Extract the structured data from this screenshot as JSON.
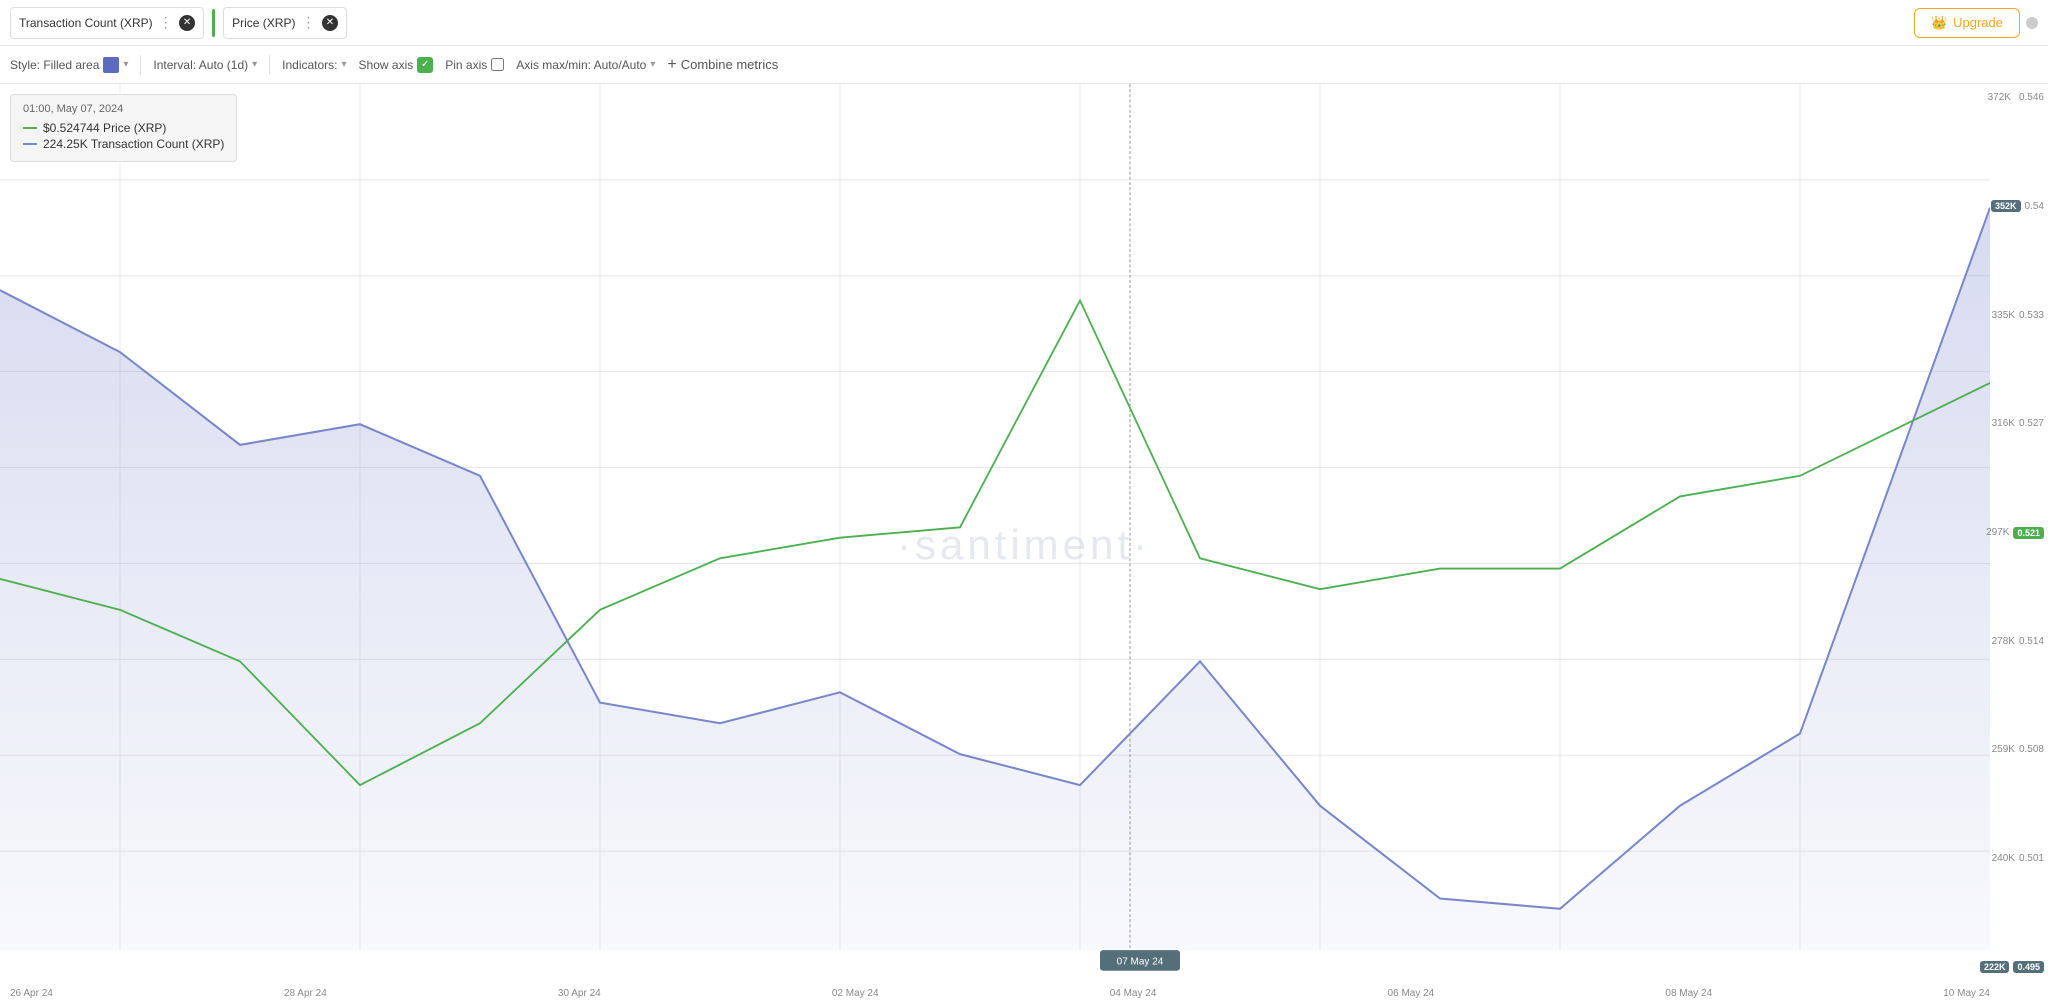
{
  "topBar": {
    "tab1": {
      "label": "Transaction Count (XRP)",
      "color": "#5c6bc0"
    },
    "tab2": {
      "label": "Price (XRP)"
    },
    "dividerColor": "#4caf50"
  },
  "toolbar": {
    "style_label": "Style: Filled area",
    "interval_label": "Interval: Auto (1d)",
    "indicators_label": "Indicators:",
    "show_axis_label": "Show axis",
    "pin_axis_label": "Pin axis",
    "axis_maxmin_label": "Axis max/min: Auto/Auto",
    "combine_metrics_label": "Combine metrics"
  },
  "tooltip": {
    "date": "01:00, May 07, 2024",
    "price_label": "$0.524744 Price (XRP)",
    "tx_label": "224.25K Transaction Count (XRP)"
  },
  "rightAxis": {
    "top_label": "372K",
    "labels": [
      "372K",
      "352K",
      "335K",
      "316K",
      "297K",
      "278K",
      "259K",
      "240K",
      "222K"
    ],
    "price_labels": [
      "0.546",
      "0.54",
      "0.533",
      "0.527",
      "0.521",
      "0.514",
      "0.508",
      "0.501",
      "0.495"
    ],
    "badge_352k": "352K",
    "badge_052": "0.521",
    "badge_0495": "0.495"
  },
  "bottomAxis": {
    "labels": [
      "26 Apr 24",
      "28 Apr 24",
      "30 Apr 24",
      "02 May 24",
      "04 May 24",
      "06 May 24",
      "07 May 24",
      "08 May 24",
      "10 May 24"
    ]
  },
  "watermark": "·santiment·",
  "upgradeButton": "Upgrade",
  "colors": {
    "green": "#4caf50",
    "blue": "#7986cb",
    "blueArea": "rgba(121,134,203,0.18)",
    "accent": "#f5a623"
  }
}
